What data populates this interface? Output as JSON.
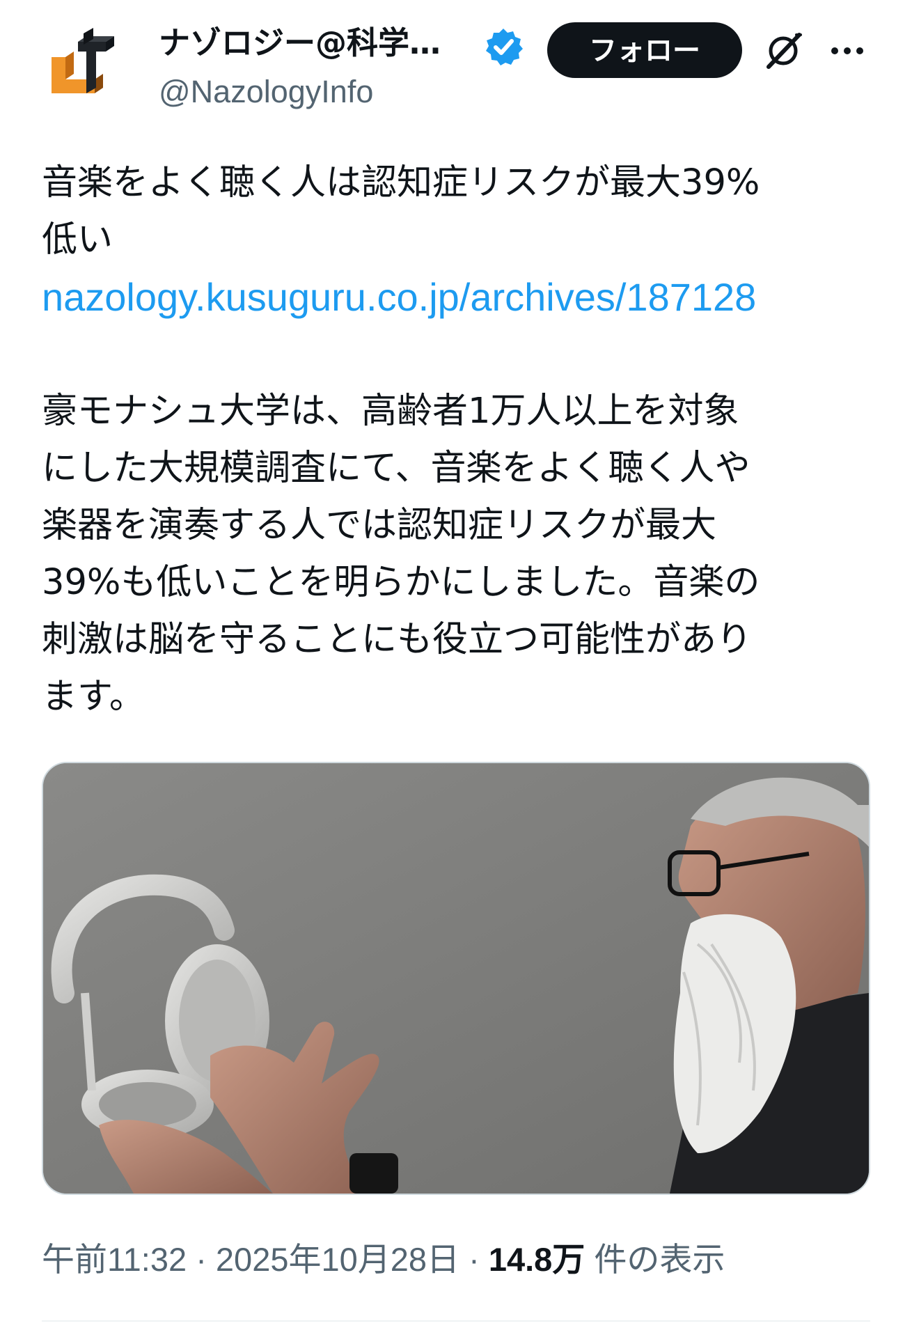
{
  "author": {
    "display_name": "ナゾロジー@科学…",
    "handle": "@NazologyInfo",
    "verified": true,
    "avatar_icon": "nazology-logo-icon"
  },
  "actions": {
    "follow_label": "フォロー",
    "grok_icon": "grok-icon",
    "more_icon": "more-dots-icon"
  },
  "tweet": {
    "lines_1": [
      "音楽をよく聴く人は認知症リスクが最大39%",
      "低い"
    ],
    "link": "nazology.kusuguru.co.jp/archives/187128",
    "lines_2": [
      "豪モナシュ大学は、高齢者1万人以上を対象",
      "にした大規模調査にて、音楽をよく聴く人や",
      "楽器を演奏する人では認知症リスクが最大",
      "39%も低いことを明らかにしました。音楽の",
      "刺激は脳を守ることにも役立つ可能性があり",
      "ます。"
    ]
  },
  "media": {
    "description_icon": "photo-man-holding-headphones"
  },
  "meta": {
    "time": "午前11:32",
    "sep1": " · ",
    "date": "2025年10月28日",
    "sep2": " · ",
    "views_count": "14.8万",
    "views_label": " 件の表示"
  },
  "colors": {
    "text": "#0f1419",
    "secondary": "#536471",
    "link": "#1d9bf0",
    "verified": "#1d9bf0",
    "follow_bg": "#0f1419"
  }
}
